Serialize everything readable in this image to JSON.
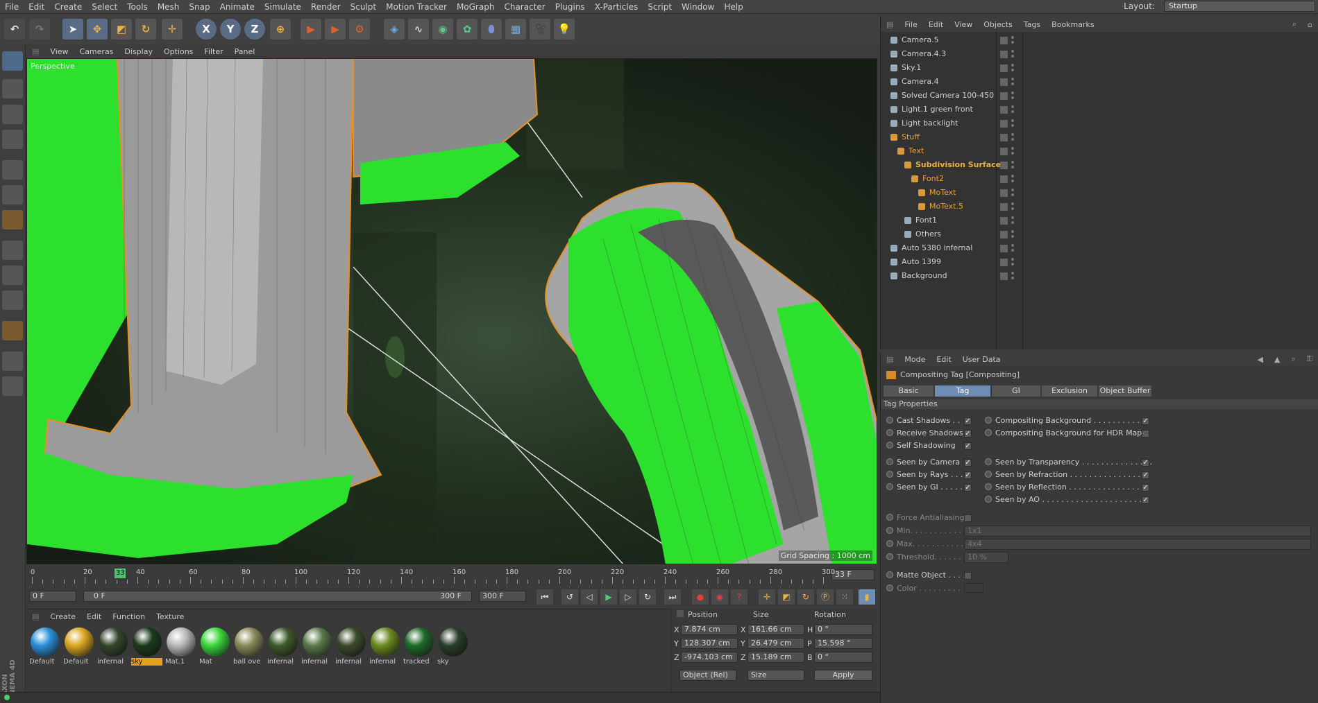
{
  "menubar": {
    "items": [
      "File",
      "Edit",
      "Create",
      "Select",
      "Tools",
      "Mesh",
      "Snap",
      "Animate",
      "Simulate",
      "Render",
      "Sculpt",
      "Motion Tracker",
      "MoGraph",
      "Character",
      "Plugins",
      "X-Particles",
      "Script",
      "Window",
      "Help"
    ],
    "layout_label": "Layout:",
    "layout_value": "Startup"
  },
  "toolbar": {
    "x_label": "X",
    "y_label": "Y",
    "z_label": "Z"
  },
  "viewport": {
    "menu": [
      "View",
      "Cameras",
      "Display",
      "Options",
      "Filter",
      "Panel"
    ],
    "label": "Perspective",
    "grid_spacing": "Grid Spacing : 1000 cm"
  },
  "timeline": {
    "ticks": [
      "0",
      "20",
      "40",
      "60",
      "80",
      "100",
      "120",
      "140",
      "160",
      "180",
      "200",
      "220",
      "240",
      "260",
      "280",
      "300"
    ],
    "current_marker": "33",
    "current_frame": "33 F",
    "start_frame": "0 F",
    "range_start": "0 F",
    "range_end": "300 F",
    "end_frame": "300 F"
  },
  "material_manager": {
    "menu": [
      "Create",
      "Edit",
      "Function",
      "Texture"
    ],
    "materials": [
      {
        "name": "Default",
        "color": "#2a8fd8"
      },
      {
        "name": "Default",
        "color": "#d9a620"
      },
      {
        "name": "infernal",
        "color": "#34452c"
      },
      {
        "name": "sky",
        "color": "#1d3a1d"
      },
      {
        "name": "Mat.1",
        "color": "#b8b8b8"
      },
      {
        "name": "Mat",
        "color": "#3ad63a"
      },
      {
        "name": "ball ove",
        "color": "#8a8a5a"
      },
      {
        "name": "infernal",
        "color": "#3e5a2a"
      },
      {
        "name": "infernal",
        "color": "#5a7a4a"
      },
      {
        "name": "infernal",
        "color": "#3a4a2a"
      },
      {
        "name": "infernal",
        "color": "#6a8a20"
      },
      {
        "name": "tracked",
        "color": "#1f6a2a"
      },
      {
        "name": "sky",
        "color": "#2a3e2a"
      }
    ]
  },
  "coordinates": {
    "headers": [
      "Position",
      "Size",
      "Rotation"
    ],
    "rows": [
      {
        "axis": "X",
        "pos": "7.874 cm",
        "size_axis": "X",
        "size": "161.66 cm",
        "rot_axis": "H",
        "rot": "0 °"
      },
      {
        "axis": "Y",
        "pos": "128.307 cm",
        "size_axis": "Y",
        "size": "26.479 cm",
        "rot_axis": "P",
        "rot": "15.598 °"
      },
      {
        "axis": "Z",
        "pos": "-974.103 cm",
        "size_axis": "Z",
        "size": "15.189 cm",
        "rot_axis": "B",
        "rot": "0 °"
      }
    ],
    "mode": "Object (Rel)",
    "size_mode": "Size",
    "apply": "Apply"
  },
  "object_manager": {
    "menu": [
      "File",
      "Edit",
      "View",
      "Objects",
      "Tags",
      "Bookmarks"
    ],
    "objects": [
      {
        "name": "Camera.5",
        "indent": 0,
        "color": "#d0d0d0"
      },
      {
        "name": "Camera.4.3",
        "indent": 0,
        "color": "#d0d0d0"
      },
      {
        "name": "Sky.1",
        "indent": 0,
        "color": "#d0d0d0"
      },
      {
        "name": "Camera.4",
        "indent": 0,
        "color": "#d0d0d0"
      },
      {
        "name": "Solved Camera 100-450",
        "indent": 0,
        "color": "#d0d0d0"
      },
      {
        "name": "Light.1 green front",
        "indent": 0,
        "color": "#d0d0d0"
      },
      {
        "name": "Light backlight",
        "indent": 0,
        "color": "#d0d0d0"
      },
      {
        "name": "Stuff",
        "indent": 0,
        "color": "#e8a33c"
      },
      {
        "name": "Text",
        "indent": 1,
        "color": "#e8a33c"
      },
      {
        "name": "Subdivision Surface",
        "indent": 2,
        "color": "#f0b040"
      },
      {
        "name": "Font2",
        "indent": 3,
        "color": "#e8a33c"
      },
      {
        "name": "MoText",
        "indent": 4,
        "color": "#e8a33c"
      },
      {
        "name": "MoText.5",
        "indent": 4,
        "color": "#e8a33c"
      },
      {
        "name": "Font1",
        "indent": 2,
        "color": "#d0d0d0"
      },
      {
        "name": "Others",
        "indent": 2,
        "color": "#d0d0d0"
      },
      {
        "name": "Auto 5380 infernal",
        "indent": 0,
        "color": "#d0d0d0"
      },
      {
        "name": "Auto 1399",
        "indent": 0,
        "color": "#d0d0d0"
      },
      {
        "name": "Background",
        "indent": 0,
        "color": "#d0d0d0"
      }
    ]
  },
  "attributes": {
    "menu": [
      "Mode",
      "Edit",
      "User Data"
    ],
    "title": "Compositing Tag [Compositing]",
    "tabs": [
      "Basic",
      "Tag",
      "GI",
      "Exclusion",
      "Object Buffer"
    ],
    "section": "Tag Properties",
    "left_props": [
      {
        "label": "Cast Shadows . .",
        "checked": "✓"
      },
      {
        "label": "Receive Shadows",
        "checked": "✓"
      },
      {
        "label": "Self Shadowing",
        "checked": "✓"
      },
      {
        "label": "Seen by Camera",
        "checked": "✓"
      },
      {
        "label": "Seen by Rays . . .",
        "checked": "✓"
      },
      {
        "label": "Seen by GI . . . . .",
        "checked": "✓"
      }
    ],
    "right_props": [
      {
        "label": "Compositing Background . . . . . . . . . . . .",
        "checked": "✓"
      },
      {
        "label": "Compositing Background for HDR Maps",
        "checked": ""
      },
      {
        "label": "Seen by Transparency . . . . . . . . . . . . . . .",
        "checked": "✓"
      },
      {
        "label": "Seen by Refraction . . . . . . . . . . . . . . . . .",
        "checked": "✓"
      },
      {
        "label": "Seen by Reflection . . . . . . . . . . . . . . . . .",
        "checked": "✓"
      },
      {
        "label": "Seen by AO . . . . . . . . . . . . . . . . . . . . . .",
        "checked": "✓"
      }
    ],
    "force_aa": "Force Antialiasing",
    "min_label": "Min. . . . . . . . . . . .",
    "min_value": "1x1",
    "max_label": "Max. . . . . . . . . . . .",
    "max_value": "4x4",
    "threshold_label": "Threshold. . . . . .",
    "threshold_value": "10 %",
    "matte_label": "Matte Object . . . .",
    "color_label": "Color . . . . . . . . ."
  },
  "branding": "MAXON CINEMA 4D"
}
